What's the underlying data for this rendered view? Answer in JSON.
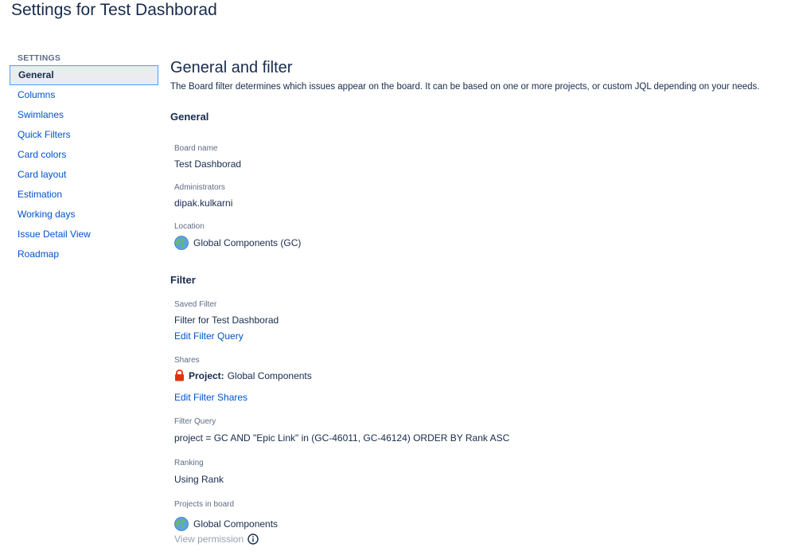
{
  "page": {
    "title": "Settings for Test Dashborad"
  },
  "sidebar": {
    "heading": "SETTINGS",
    "items": [
      {
        "label": "General"
      },
      {
        "label": "Columns"
      },
      {
        "label": "Swimlanes"
      },
      {
        "label": "Quick Filters"
      },
      {
        "label": "Card colors"
      },
      {
        "label": "Card layout"
      },
      {
        "label": "Estimation"
      },
      {
        "label": "Working days"
      },
      {
        "label": "Issue Detail View"
      },
      {
        "label": "Roadmap"
      }
    ]
  },
  "main": {
    "title": "General and filter",
    "description": "The Board filter determines which issues appear on the board. It can be based on one or more projects, or custom JQL depending on your needs.",
    "general": {
      "heading": "General",
      "board_name_label": "Board name",
      "board_name_value": "Test Dashborad",
      "administrators_label": "Administrators",
      "administrators_value": "dipak.kulkarni",
      "location_label": "Location",
      "location_value": "Global Components (GC)",
      "location_icon": "globe-icon"
    },
    "filter": {
      "heading": "Filter",
      "saved_filter_label": "Saved Filter",
      "saved_filter_value": "Filter for Test Dashborad",
      "edit_query_link": "Edit Filter Query",
      "shares_label": "Shares",
      "shares_type": "Project:",
      "shares_value": "Global Components",
      "shares_icon": "lock-icon",
      "edit_shares_link": "Edit Filter Shares",
      "query_label": "Filter Query",
      "query_value": "project = GC AND \"Epic Link\" in (GC-46011, GC-46124) ORDER BY Rank ASC",
      "ranking_label": "Ranking",
      "ranking_value": "Using Rank",
      "projects_label": "Projects in board",
      "projects_value": "Global Components",
      "view_permission_link": "View permission",
      "info_icon": "info-icon"
    }
  },
  "colors": {
    "text": "#172b4d",
    "link": "#0052cc",
    "muted": "#5e6c84",
    "active_bg": "#ebecf0",
    "active_border": "#4c9aff",
    "lock": "#de350b"
  }
}
